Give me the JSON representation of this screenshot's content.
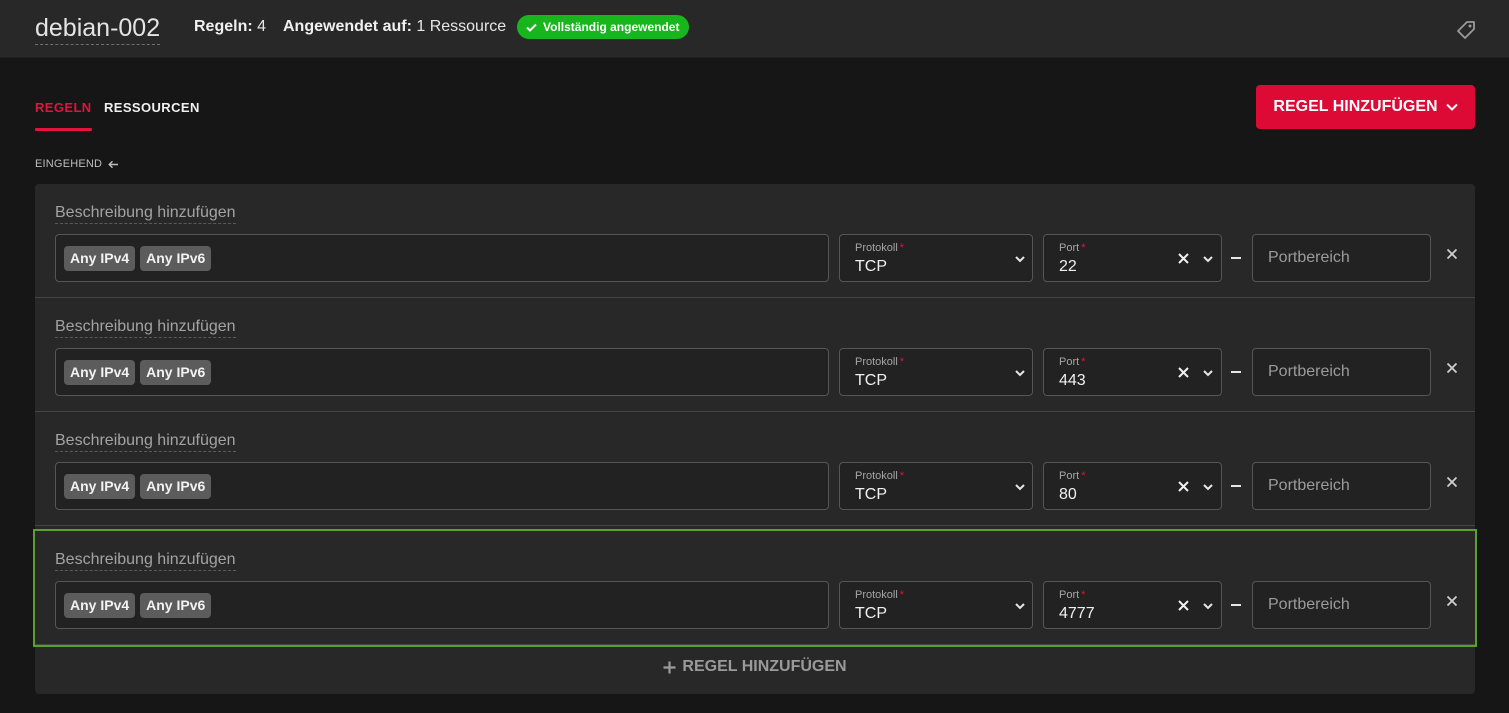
{
  "header": {
    "firewall_name": "debian-002",
    "rules_label": "Regeln:",
    "rules_count": "4",
    "applied_label": "Angewendet auf:",
    "applied_value": "1 Ressource",
    "status": "Vollständig angewendet",
    "status_color": "#19b51c",
    "tag_icon": "tag-icon"
  },
  "tabs": [
    {
      "label": "REGELN",
      "active": true
    },
    {
      "label": "RESSOURCEN",
      "active": false
    }
  ],
  "add_rule_button": "REGEL HINZUFÜGEN",
  "direction_label": "EINGEHEND",
  "accent_color": "#dc0a35",
  "rules": [
    {
      "description": "Beschreibung hinzufügen",
      "sources": [
        "Any IPv4",
        "Any IPv6"
      ],
      "protocol_label": "Protokoll",
      "protocol": "TCP",
      "port_label": "Port",
      "port": "22",
      "range_placeholder": "Portbereich"
    },
    {
      "description": "Beschreibung hinzufügen",
      "sources": [
        "Any IPv4",
        "Any IPv6"
      ],
      "protocol_label": "Protokoll",
      "protocol": "TCP",
      "port_label": "Port",
      "port": "443",
      "range_placeholder": "Portbereich"
    },
    {
      "description": "Beschreibung hinzufügen",
      "sources": [
        "Any IPv4",
        "Any IPv6"
      ],
      "protocol_label": "Protokoll",
      "protocol": "TCP",
      "port_label": "Port",
      "port": "80",
      "range_placeholder": "Portbereich"
    },
    {
      "description": "Beschreibung hinzufügen",
      "sources": [
        "Any IPv4",
        "Any IPv6"
      ],
      "protocol_label": "Protokoll",
      "protocol": "TCP",
      "port_label": "Port",
      "port": "4777",
      "range_placeholder": "Portbereich"
    }
  ],
  "add_rule_bottom": "REGEL HINZUFÜGEN"
}
